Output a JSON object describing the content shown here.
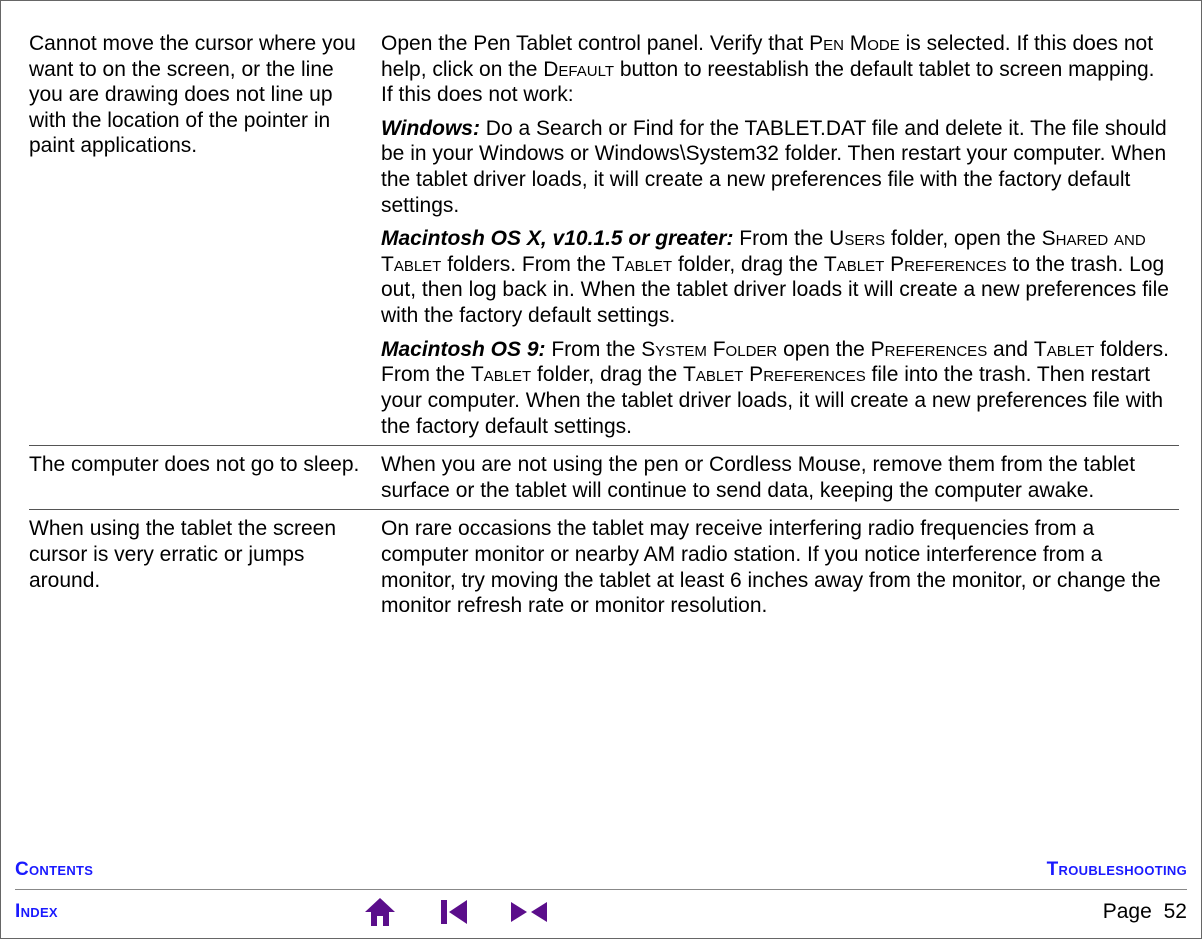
{
  "rows": [
    {
      "problem": "Cannot move the cursor where you want to on the screen, or the line you are drawing does not line up with the location of the pointer in paint applications.",
      "solution": [
        {
          "type": "plain",
          "runs": [
            {
              "t": "Open the Pen Tablet control panel.  Verify that "
            },
            {
              "t": "Pen Mode",
              "cls": "sc"
            },
            {
              "t": " is selected.  If this does not help, click on the "
            },
            {
              "t": "Default",
              "cls": "sc"
            },
            {
              "t": " button to reestablish the default tablet to screen mapping.  If this does not work:"
            }
          ]
        },
        {
          "type": "plain",
          "runs": [
            {
              "t": "Windows: ",
              "cls": "bi"
            },
            {
              "t": "Do a Search or Find for the TABLET.DAT file and delete it. The file should be in your Windows or Windows\\System32 folder. Then restart your computer.  When the tablet driver loads, it will create a new preferences file with the factory default settings."
            }
          ]
        },
        {
          "type": "plain",
          "runs": [
            {
              "t": "Macintosh OS X, v10.1.5 or greater: ",
              "cls": "bi"
            },
            {
              "t": "From the "
            },
            {
              "t": "Users",
              "cls": "sc"
            },
            {
              "t": " folder, open the "
            },
            {
              "t": "Shared and Tablet",
              "cls": "sc"
            },
            {
              "t": " folders.  From the "
            },
            {
              "t": "Tablet",
              "cls": "sc"
            },
            {
              "t": " folder, drag the "
            },
            {
              "t": "Tablet Preferences",
              "cls": "sc"
            },
            {
              "t": " to the trash.  Log out, then log back in.  When the tablet driver loads it will create a new preferences file with the factory default settings."
            }
          ]
        },
        {
          "type": "plain",
          "runs": [
            {
              "t": "Macintosh OS 9: ",
              "cls": "bi"
            },
            {
              "t": "From the "
            },
            {
              "t": "System Folder",
              "cls": "sc"
            },
            {
              "t": " open the "
            },
            {
              "t": "Preferences",
              "cls": "sc"
            },
            {
              "t": " and "
            },
            {
              "t": "Tablet",
              "cls": "sc"
            },
            {
              "t": " folders.  From the "
            },
            {
              "t": "Tablet",
              "cls": "sc"
            },
            {
              "t": " folder, drag the "
            },
            {
              "t": "Tablet Preferences",
              "cls": "sc"
            },
            {
              "t": " file into the trash.  Then restart your computer.  When the tablet driver loads, it will create a new preferences file with the factory default settings."
            }
          ]
        }
      ]
    },
    {
      "problem": "The computer does not go to sleep.",
      "solution": [
        {
          "type": "plain",
          "runs": [
            {
              "t": "When you are not using the pen or Cordless Mouse, remove them from the tablet surface or the tablet will continue to send data, keeping the computer awake."
            }
          ]
        }
      ]
    },
    {
      "problem": "When using the tablet the screen cursor is very erratic or jumps around.",
      "solution": [
        {
          "type": "plain",
          "runs": [
            {
              "t": "On rare occasions the tablet may receive interfering radio frequencies from a computer monitor or nearby AM radio station.  If you notice interference from a monitor, try moving the tablet at least 6 inches away from the monitor, or change the monitor refresh rate or monitor resolution."
            }
          ]
        }
      ]
    }
  ],
  "footer": {
    "contents": "Contents",
    "troubleshooting": "Troubleshooting",
    "index": "Index",
    "page_label": "Page",
    "page_number": "52"
  }
}
